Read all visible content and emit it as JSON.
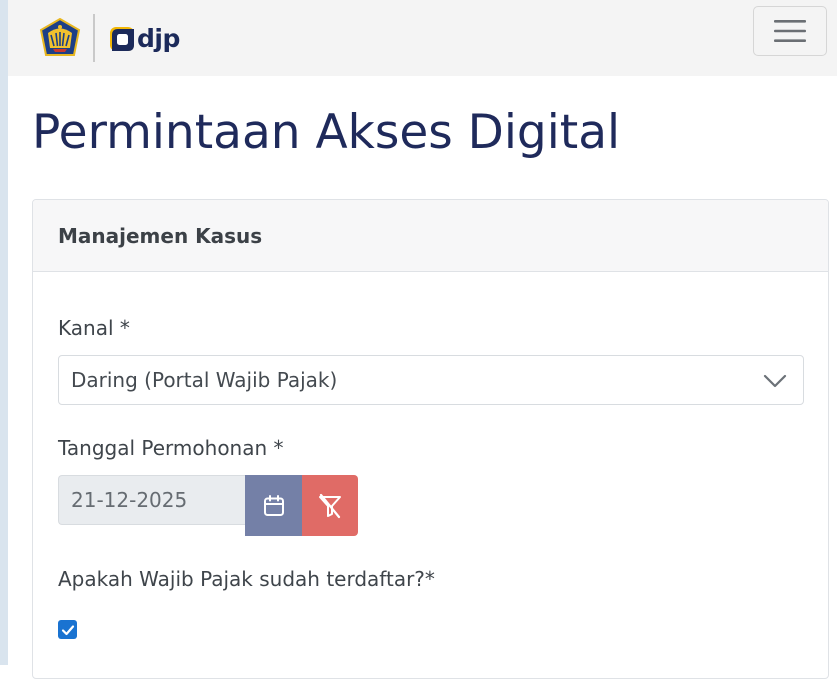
{
  "header": {
    "logo_text": "djp",
    "menu_toggle": "hamburger-menu-icon"
  },
  "page": {
    "title": "Permintaan Akses Digital"
  },
  "card": {
    "title": "Manajemen Kasus",
    "kanal": {
      "label": "Kanal *",
      "selected": "Daring (Portal Wajib Pajak)"
    },
    "tanggal": {
      "label": "Tanggal Permohonan *",
      "value": "21-12-2025",
      "calendar_icon": "calendar-icon",
      "clear_icon": "filter-clear-icon"
    },
    "terdaftar": {
      "label": "Apakah Wajib Pajak sudah terdaftar?*",
      "checked": true
    }
  },
  "colors": {
    "title": "#1f2a5b",
    "calendar_button": "#7480a7",
    "clear_button": "#e06b66",
    "checkbox": "#1a73d1"
  }
}
